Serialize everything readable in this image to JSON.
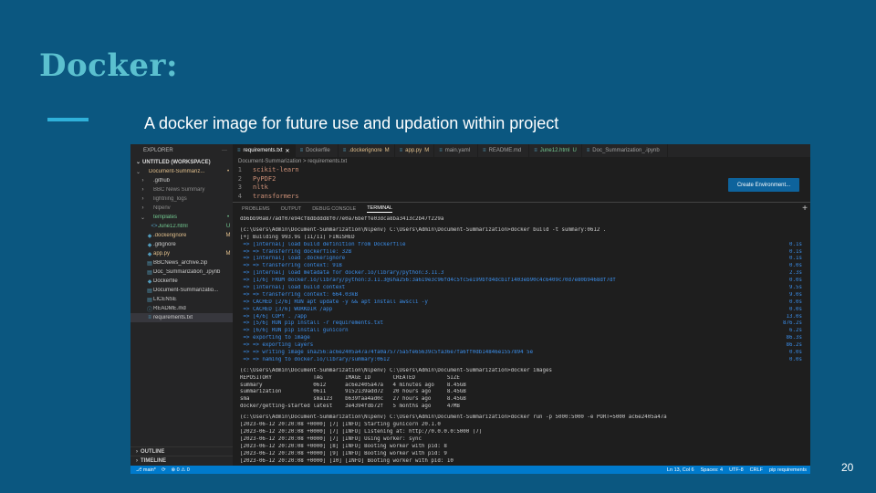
{
  "slide": {
    "title": "Docker:",
    "subtitle": "A docker image for future use and updation within project",
    "page_number": "20"
  },
  "sidebar": {
    "explorer_label": "EXPLORER",
    "more_label": "···",
    "workspace_label": "UNTITLED (WORKSPACE)",
    "items": [
      {
        "label": "Document-Summariz...",
        "badge": "•",
        "color": "#e2c08d",
        "indent": 1,
        "twisty": "⌄",
        "icon": ""
      },
      {
        "label": ".github",
        "badge": "",
        "color": "#cccccc",
        "indent": 2,
        "twisty": "›",
        "icon": ""
      },
      {
        "label": "BBC News Summary",
        "badge": "",
        "color": "#8b8b8b",
        "indent": 2,
        "twisty": "›",
        "icon": ""
      },
      {
        "label": "lightning_logs",
        "badge": "",
        "color": "#8b8b8b",
        "indent": 2,
        "twisty": "›",
        "icon": ""
      },
      {
        "label": "Nlpenv",
        "badge": "",
        "color": "#8b8b8b",
        "indent": 2,
        "twisty": "›",
        "icon": ""
      },
      {
        "label": "templates",
        "badge": "•",
        "color": "#73c991",
        "indent": 2,
        "twisty": "⌄",
        "icon": ""
      },
      {
        "label": "June12.html",
        "badge": "U",
        "color": "#73c991",
        "indent": 3,
        "twisty": "",
        "icon": "<>"
      },
      {
        "label": ".dockerignore",
        "badge": "M",
        "color": "#e2c08d",
        "indent": 2,
        "twisty": "",
        "icon": "◆"
      },
      {
        "label": ".gitignore",
        "badge": "",
        "color": "#cccccc",
        "indent": 2,
        "twisty": "",
        "icon": "◆"
      },
      {
        "label": "app.py",
        "badge": "M",
        "color": "#e2c08d",
        "indent": 2,
        "twisty": "",
        "icon": "◆"
      },
      {
        "label": "BBCNews_archive.zip",
        "badge": "",
        "color": "#cccccc",
        "indent": 2,
        "twisty": "",
        "icon": "▤"
      },
      {
        "label": "Doc_Summarization_.ipynb",
        "badge": "",
        "color": "#cccccc",
        "indent": 2,
        "twisty": "",
        "icon": "▤"
      },
      {
        "label": "Dockerfile",
        "badge": "",
        "color": "#cccccc",
        "indent": 2,
        "twisty": "",
        "icon": "◆"
      },
      {
        "label": "Document-Summarizatio...",
        "badge": "",
        "color": "#cccccc",
        "indent": 2,
        "twisty": "",
        "icon": "▤"
      },
      {
        "label": "LICENSE",
        "badge": "",
        "color": "#cccccc",
        "indent": 2,
        "twisty": "",
        "icon": "▤"
      },
      {
        "label": "README.md",
        "badge": "",
        "color": "#cccccc",
        "indent": 2,
        "twisty": "",
        "icon": "ⓘ"
      },
      {
        "label": "requirements.txt",
        "badge": "",
        "color": "#cccccc",
        "indent": 2,
        "twisty": "",
        "icon": "≡",
        "active": true
      }
    ],
    "outline_label": "OUTLINE",
    "timeline_label": "TIMELINE"
  },
  "tabs": [
    {
      "label": "requirements.txt",
      "badge": "✕",
      "active": true,
      "color": "#ffffff"
    },
    {
      "label": "Dockerfile",
      "badge": "",
      "active": false,
      "color": "#a0a0a0"
    },
    {
      "label": ".dockerignore",
      "badge": "M",
      "active": false,
      "color": "#e2c08d"
    },
    {
      "label": "app.py",
      "badge": "M",
      "active": false,
      "color": "#e2c08d"
    },
    {
      "label": "main.yaml",
      "badge": "",
      "active": false,
      "color": "#a0a0a0"
    },
    {
      "label": "README.md",
      "badge": "",
      "active": false,
      "color": "#a0a0a0"
    },
    {
      "label": "June12.html",
      "badge": "U",
      "active": false,
      "color": "#73c991"
    },
    {
      "label": "Doc_Summarization_.ipynb",
      "badge": "",
      "active": false,
      "color": "#a0a0a0"
    }
  ],
  "breadcrumb": "Document-Summarization > requirements.txt",
  "editor": {
    "lines": [
      {
        "num": "1",
        "text": "scikit-learn"
      },
      {
        "num": "2",
        "text": "PyPDF2"
      },
      {
        "num": "3",
        "text": "nltk"
      },
      {
        "num": "4",
        "text": "transformers"
      }
    ],
    "env_button": "Create Environment..."
  },
  "panel": {
    "tabs": [
      "PROBLEMS",
      "OUTPUT",
      "DEBUG CONSOLE",
      "TERMINAL"
    ],
    "active_tab": "TERMINAL",
    "plus": "+"
  },
  "terminal": {
    "lines": [
      {
        "text": "db6bb90a877adf07e94cf8dbddd8f077e0a76beffe03dca8ba3413c2b47f229a",
        "blue": false,
        "time": ""
      },
      {
        "text": "",
        "blue": false,
        "time": "",
        "gap": true
      },
      {
        "text": "(c:\\Users\\Admin\\Document-Summarization\\Nlpenv) C:\\Users\\Admin\\Document-Summarization>docker build -t summary:0612 .",
        "blue": false,
        "time": ""
      },
      {
        "text": "[+] Building 993.9s (11/11) FINISHED",
        "blue": false,
        "time": ""
      },
      {
        "text": " => [internal] load build definition from Dockerfile",
        "blue": true,
        "time": "0.1s"
      },
      {
        "text": " => => transferring dockerfile: 32B",
        "blue": true,
        "time": "0.1s"
      },
      {
        "text": " => [internal] load .dockerignore",
        "blue": true,
        "time": "0.1s"
      },
      {
        "text": " => => transferring context: 91B",
        "blue": true,
        "time": "0.0s"
      },
      {
        "text": " => [internal] load metadata for docker.io/library/python:3.11.3",
        "blue": true,
        "time": "2.3s"
      },
      {
        "text": " => [1/6] FROM docker.io/library/python:3.11.3@sha256:3a619e3c96fd4c5fc5e199bfd4dcb1f1403eb90c4c6409c70d7e80b9468df7df",
        "blue": true,
        "time": "0.0s"
      },
      {
        "text": " => [internal] load build context",
        "blue": true,
        "time": "9.5s"
      },
      {
        "text": " => => transferring context: 664.03kB",
        "blue": true,
        "time": "9.0s"
      },
      {
        "text": " => CACHED [2/6] RUN apt update -y && apt install awscli -y",
        "blue": true,
        "time": "0.0s"
      },
      {
        "text": " => CACHED [3/6] WORKDIR /app",
        "blue": true,
        "time": "0.0s"
      },
      {
        "text": " => [4/6] COPY . /app",
        "blue": true,
        "time": "13.0s"
      },
      {
        "text": " => [5/6] RUN pip install -r requirements.txt",
        "blue": true,
        "time": "876.2s"
      },
      {
        "text": " => [6/6] RUN pip install gunicorn",
        "blue": true,
        "time": "6.2s"
      },
      {
        "text": " => exporting to image",
        "blue": true,
        "time": "86.3s"
      },
      {
        "text": " => => exporting layers",
        "blue": true,
        "time": "86.2s"
      },
      {
        "text": " => => writing image sha256:ac6e2405a47a74fa0a75775a5fe65639c5fa36e7fa6ff0db14846e1557894 5e",
        "blue": true,
        "time": "0.0s"
      },
      {
        "text": " => => naming to docker.io/library/summary:0612",
        "blue": true,
        "time": "0.0s"
      },
      {
        "text": "",
        "blue": false,
        "time": "",
        "gap": true
      },
      {
        "text": "(c:\\Users\\Admin\\Document-Summarization\\Nlpenv) C:\\Users\\Admin\\Document-Summarization>docker images",
        "blue": false,
        "time": ""
      },
      {
        "text": "REPOSITORY             TAG       IMAGE ID       CREATED          SIZE",
        "blue": false,
        "time": ""
      },
      {
        "text": "summary                0612      ac6e2405a47a   4 minutes ago    8.45GB",
        "blue": false,
        "time": ""
      },
      {
        "text": "summarization          0611      9152139add72   20 hours ago     8.45GB",
        "blue": false,
        "time": ""
      },
      {
        "text": "sma                    sma123    b639faa4ad0c   27 hours ago     8.45GB",
        "blue": false,
        "time": ""
      },
      {
        "text": "docker/getting-started latest    3e4394fdb72f   5 months ago     47MB",
        "blue": false,
        "time": ""
      },
      {
        "text": "",
        "blue": false,
        "time": "",
        "gap": true
      },
      {
        "text": "(c:\\Users\\Admin\\Document-Summarization\\Nlpenv) C:\\Users\\Admin\\Document-Summarization>docker run -p 5000:5000 -e PORT=5000 ac6e2405a47a",
        "blue": false,
        "time": ""
      },
      {
        "text": "[2023-06-12 20:20:08 +0000] [7] [INFO] Starting gunicorn 20.1.0",
        "blue": false,
        "time": ""
      },
      {
        "text": "[2023-06-12 20:20:08 +0000] [7] [INFO] Listening at: http://0.0.0.0:5000 (7)",
        "blue": false,
        "time": ""
      },
      {
        "text": "[2023-06-12 20:20:08 +0000] [7] [INFO] Using worker: sync",
        "blue": false,
        "time": ""
      },
      {
        "text": "[2023-06-12 20:20:08 +0000] [8] [INFO] Booting worker with pid: 8",
        "blue": false,
        "time": ""
      },
      {
        "text": "[2023-06-12 20:20:08 +0000] [9] [INFO] Booting worker with pid: 9",
        "blue": false,
        "time": ""
      },
      {
        "text": "[2023-06-12 20:20:08 +0000] [10] [INFO] Booting worker with pid: 10",
        "blue": false,
        "time": ""
      },
      {
        "text": "[2023-06-12 20:20:08 +0000] [11] [INFO] Booting worker with pid: 11",
        "blue": false,
        "time": ""
      }
    ]
  },
  "statusbar": {
    "branch": "⎇ main*",
    "sync": "⟳",
    "problems": "⊗ 0 ⚠ 0",
    "position": "Ln 13, Col 6",
    "spaces": "Spaces: 4",
    "encoding": "UTF-8",
    "eol": "CRLF",
    "language": "pip requirements"
  }
}
